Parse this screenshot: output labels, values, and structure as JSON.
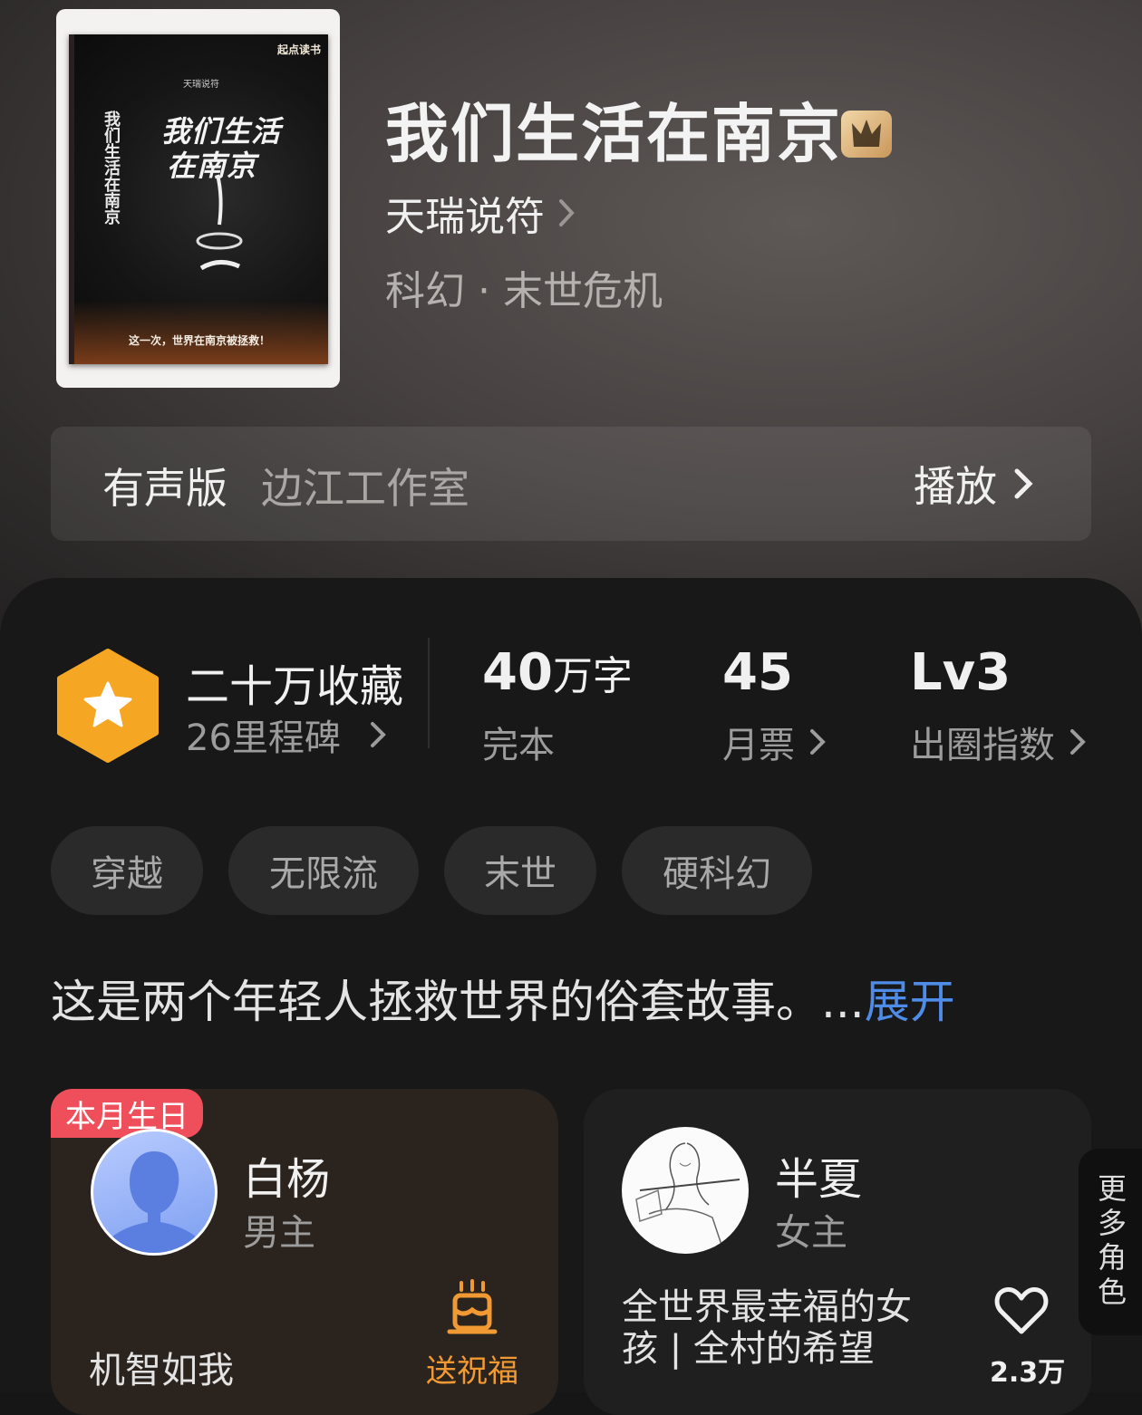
{
  "book": {
    "title": "我们生活在南京",
    "author": "天瑞说符",
    "genre": "科幻 · 末世危机",
    "cover": {
      "title_line1": "我们生活",
      "title_line2": "在南京",
      "publisher": "起点读书",
      "author_small": "天瑞说符",
      "side_text": "我们生活在南京",
      "tagline": "这一次，世界在南京被拯救！"
    }
  },
  "audio": {
    "label": "有声版",
    "studio": "边江工作室",
    "play_label": "播放"
  },
  "stats": {
    "favorites": "二十万收藏",
    "milestones": "26里程碑",
    "words_value": "40",
    "words_unit": "万字",
    "words_label": "完本",
    "votes_value": "45",
    "votes_label": "月票",
    "index_value": "Lv3",
    "index_label": "出圈指数"
  },
  "tags": [
    "穿越",
    "无限流",
    "末世",
    "硬科幻"
  ],
  "synopsis": {
    "text": "这是两个年轻人拯救世界的俗套故事。...",
    "expand": "展开"
  },
  "characters": [
    {
      "badge": "本月生日",
      "name": "白杨",
      "role": "男主",
      "quote": "机智如我",
      "action": "送祝福"
    },
    {
      "name": "半夏",
      "role": "女主",
      "quote": "全世界最幸福的女孩 | 全村的希望",
      "likes": "2.3万"
    }
  ],
  "more_roles": "更多角色",
  "colors": {
    "accent_blue": "#4f8ce8",
    "badge_orange": "#f5a623",
    "birthday_red": "#ef4f5a",
    "bless_orange": "#f19a33"
  }
}
